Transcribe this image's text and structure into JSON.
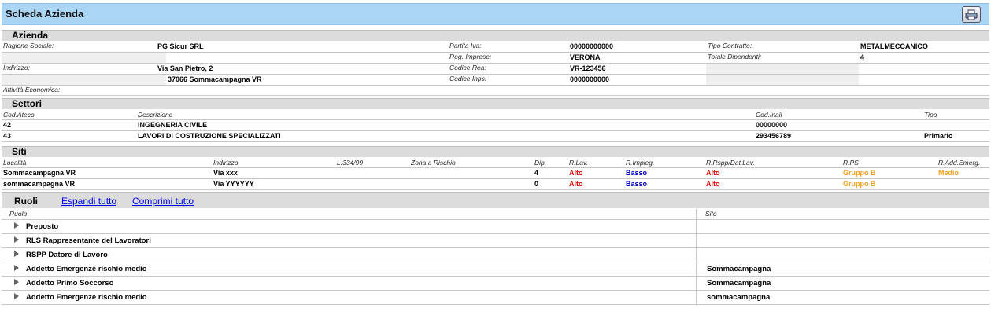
{
  "page": {
    "title": "Scheda Azienda",
    "print_icon": "printer-icon"
  },
  "azienda": {
    "section": "Azienda",
    "ragione_sociale_label": "Ragione Sociale:",
    "ragione_sociale": "PG Sicur SRL",
    "partita_iva_label": "Partita Iva:",
    "partita_iva": "00000000000",
    "tipo_contratto_label": "Tipo Contratto:",
    "tipo_contratto": "METALMECCANICO",
    "reg_imprese_label": "Reg. Imprese:",
    "reg_imprese": "VERONA",
    "totale_dipendenti_label": "Totale Dipendenti:",
    "totale_dipendenti": "4",
    "indirizzo_label": "Indirizzo:",
    "indirizzo_1": "Via San Pietro, 2",
    "indirizzo_2": "37066 Sommacampagna VR",
    "codice_rea_label": "Codice Rea:",
    "codice_rea": "VR-123456",
    "codice_inps_label": "Codice Inps:",
    "codice_inps": "0000000000",
    "attivita_label": "Attività Economica:"
  },
  "settori": {
    "section": "Settori",
    "headers": {
      "cod_ateco": "Cod.Ateco",
      "descrizione": "Descrizione",
      "cod_inail": "Cod.Inail",
      "tipo": "Tipo"
    },
    "rows": [
      {
        "cod_ateco": "42",
        "descrizione": "INGEGNERIA CIVILE",
        "cod_inail": "00000000",
        "tipo": ""
      },
      {
        "cod_ateco": "43",
        "descrizione": "LAVORI DI COSTRUZIONE SPECIALIZZATI",
        "cod_inail": "293456789",
        "tipo": "Primario"
      }
    ]
  },
  "siti": {
    "section": "Siti",
    "headers": {
      "localita": "Località",
      "indirizzo": "Indirizzo",
      "l334": "L.334/99",
      "zona": "Zona a Rischio",
      "dip": "Dip.",
      "rlav": "R.Lav.",
      "rimpieg": "R.Impieg.",
      "rrspp": "R.Rspp/Dat.Lav.",
      "rps": "R.PS",
      "radd": "R.Add.Emerg."
    },
    "rows": [
      {
        "localita": "Sommacampagna VR",
        "indirizzo": "Via xxx",
        "dip": "4",
        "rlav": "Alto",
        "rimpieg": "Basso",
        "rrspp": "Alto",
        "rps": "Gruppo B",
        "radd": "Medio"
      },
      {
        "localita": "sommacampagna VR",
        "indirizzo": "Via YYYYYY",
        "dip": "0",
        "rlav": "Alto",
        "rimpieg": "Basso",
        "rrspp": "Alto",
        "rps": "Gruppo B",
        "radd": ""
      }
    ]
  },
  "ruoli": {
    "section": "Ruoli",
    "expand_all": "Espandi tutto",
    "collapse_all": "Comprimi tutto",
    "headers": {
      "ruolo": "Ruolo",
      "sito": "Sito"
    },
    "rows": [
      {
        "ruolo": "Preposto",
        "sito": ""
      },
      {
        "ruolo": "RLS Rappresentante del Lavoratori",
        "sito": ""
      },
      {
        "ruolo": "RSPP Datore di Lavoro",
        "sito": ""
      },
      {
        "ruolo": "Addetto Emergenze rischio medio",
        "sito": "Sommacampagna"
      },
      {
        "ruolo": "Addetto Primo Soccorso",
        "sito": "Sommacampagna"
      },
      {
        "ruolo": "Addetto Emergenze rischio medio",
        "sito": "sommacampagna"
      }
    ]
  }
}
